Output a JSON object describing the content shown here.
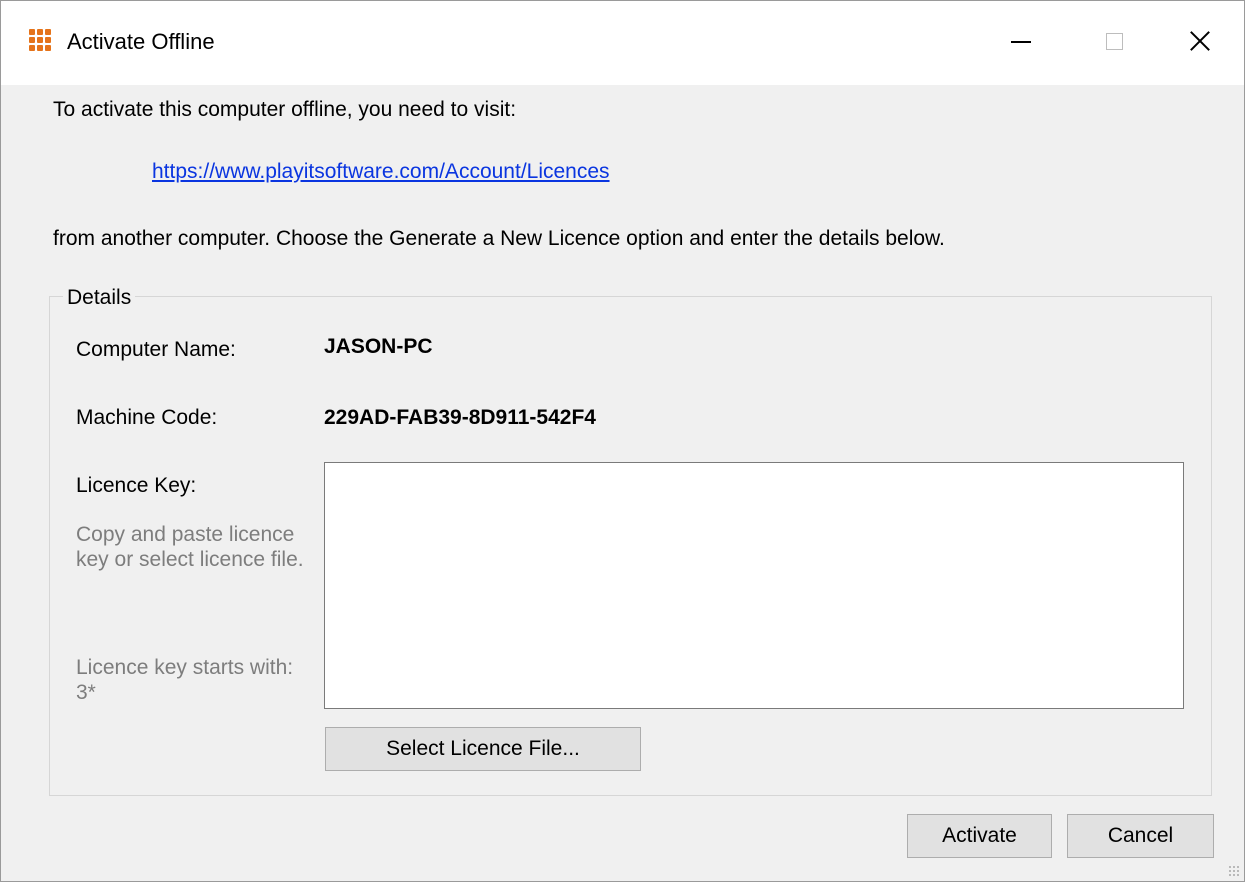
{
  "window": {
    "title": "Activate Offline",
    "controls": {
      "minimize": "minimize",
      "maximize": "maximize",
      "close": "close"
    }
  },
  "intro_text": "To activate this computer offline, you need to visit:",
  "link_text": "https://www.playitsoftware.com/Account/Licences",
  "instruction_text": "from another computer. Choose the Generate a New Licence option and enter the details below.",
  "details": {
    "legend": "Details",
    "computer_name_label": "Computer Name:",
    "computer_name_value": "JASON-PC",
    "machine_code_label": "Machine Code:",
    "machine_code_value": "229AD-FAB39-8D911-542F4",
    "licence_key_label": "Licence Key:",
    "hint_copy": "Copy and paste licence key or select licence file.",
    "hint_starts": "Licence key starts with: 3*",
    "licence_key_value": "",
    "select_file_button": "Select Licence File..."
  },
  "buttons": {
    "activate": "Activate",
    "cancel": "Cancel"
  },
  "colors": {
    "link": "#0a35e0",
    "hint": "#7d7d7d",
    "icon": "#e5731a"
  }
}
